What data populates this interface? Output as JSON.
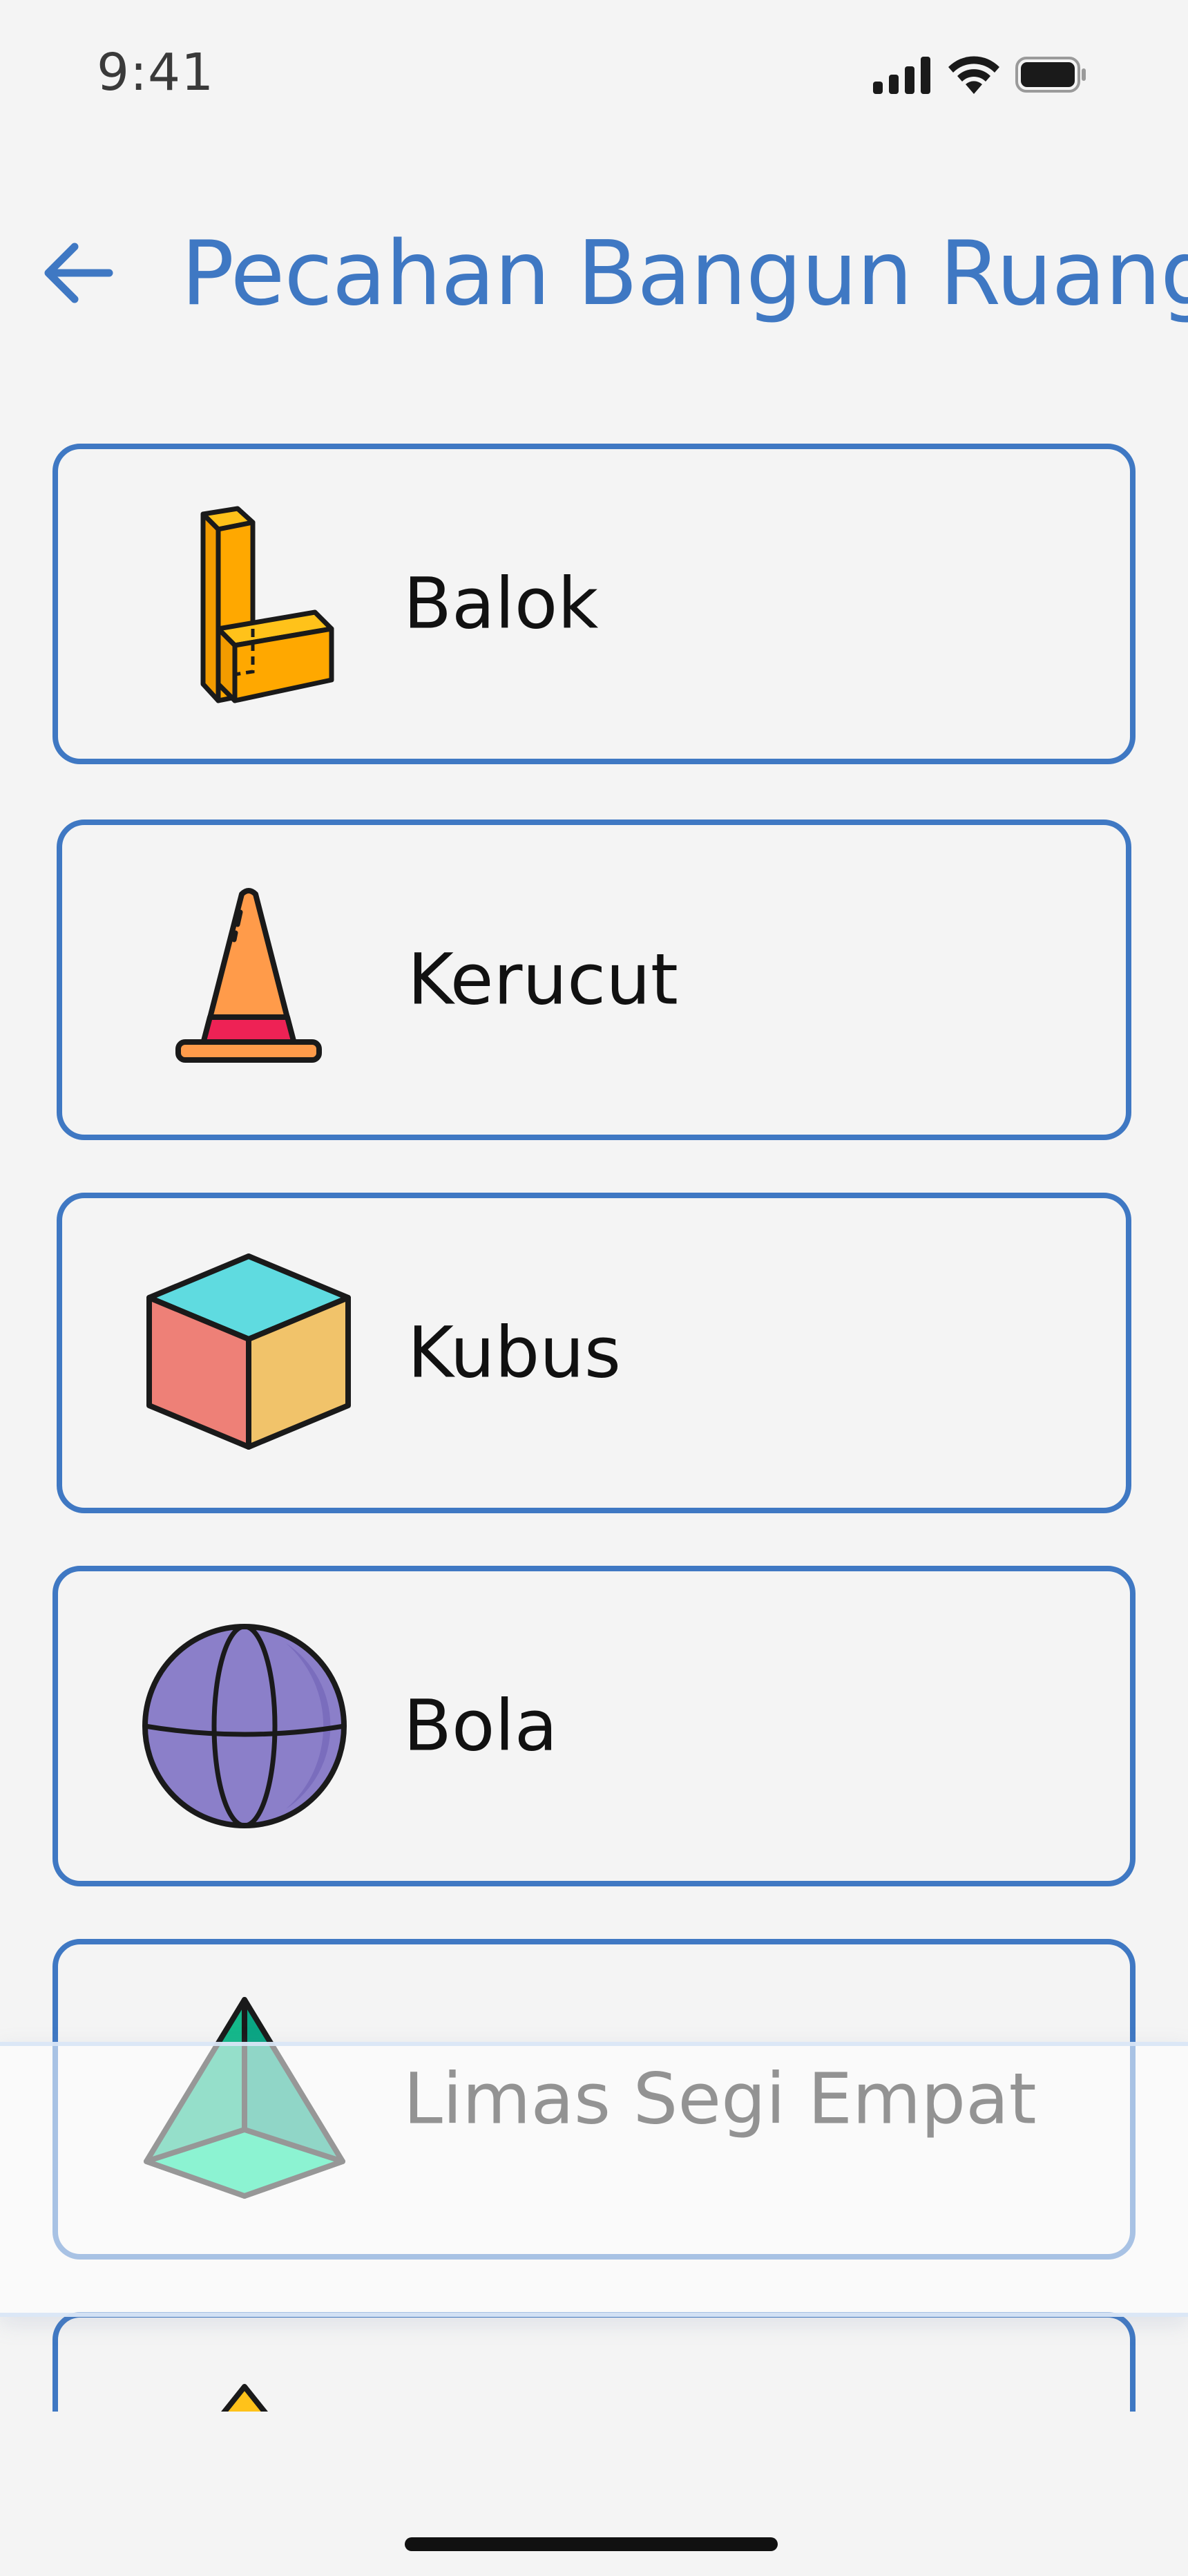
{
  "status_bar": {
    "time": "9:41",
    "icons": [
      "cellular-signal-icon",
      "wifi-icon",
      "battery-icon"
    ]
  },
  "header": {
    "back_icon": "arrow-left-icon",
    "title": "Pecahan Bangun Ruang"
  },
  "shapes": [
    {
      "label": "Balok",
      "icon": "cuboid-blocks-icon"
    },
    {
      "label": "Kerucut",
      "icon": "traffic-cone-icon"
    },
    {
      "label": "Kubus",
      "icon": "cube-icon"
    },
    {
      "label": "Bola",
      "icon": "sphere-icon"
    },
    {
      "label": "Limas Segi Empat",
      "icon": "square-pyramid-icon"
    },
    {
      "label": "",
      "icon": "partially-visible-shape-icon"
    }
  ],
  "colors": {
    "accent": "#3f78c3",
    "background": "#f4f4f4"
  }
}
